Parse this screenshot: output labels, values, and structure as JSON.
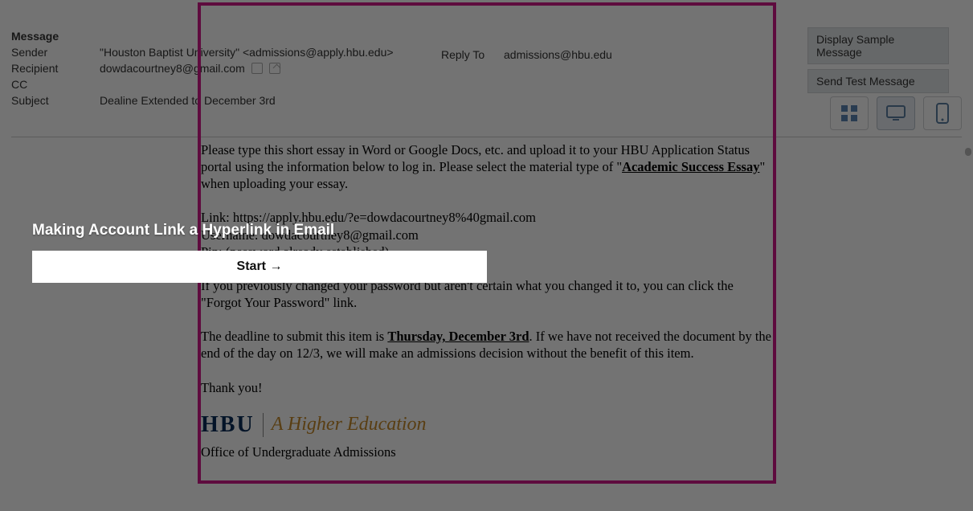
{
  "header": {
    "message_label": "Message",
    "sender_label": "Sender",
    "sender_value": "\"Houston Baptist University\" <admissions@apply.hbu.edu>",
    "replyto_label": "Reply To",
    "replyto_value": "admissions@hbu.edu",
    "recipient_label": "Recipient",
    "recipient_value": "dowdacourtney8@gmail.com",
    "cc_label": "CC",
    "cc_value": "",
    "subject_label": "Subject",
    "subject_value": "Dealine Extended to December 3rd"
  },
  "side": {
    "display_sample": "Display Sample Message",
    "send_test": "Send Test Message"
  },
  "body": {
    "p1a": "Please type this short essay in Word or Google Docs, etc. and upload it to your HBU Application Status portal using the information below to log in. Please select the material type of \"",
    "p1b": "Academic Success Essay",
    "p1c": "\" when uploading your essay.",
    "link_label": "Link: ",
    "link_url": "https://apply.hbu.edu/?e=dowdacourtney8%40gmail.com",
    "username": "Username: dowdacourtney8@gmail.com",
    "pin": "Pin: (password already established)",
    "forgot": "If you previously changed your password but aren't certain what you changed it to, you can click the \"Forgot Your Password\" link.",
    "deadline_a": "The deadline to submit this item is ",
    "deadline_b": "Thursday, December 3rd",
    "deadline_c": ".  If we have not received the document by the end of the day on 12/3, we will make an admissions decision without the benefit of this item.",
    "thanks": "Thank you!",
    "logo_hbu": "HBU",
    "logo_tag": "A Higher Education",
    "office": "Office of Undergraduate Admissions"
  },
  "tutorial": {
    "title": "Making Account Link a Hyperlink in Email",
    "start": "Start →"
  }
}
